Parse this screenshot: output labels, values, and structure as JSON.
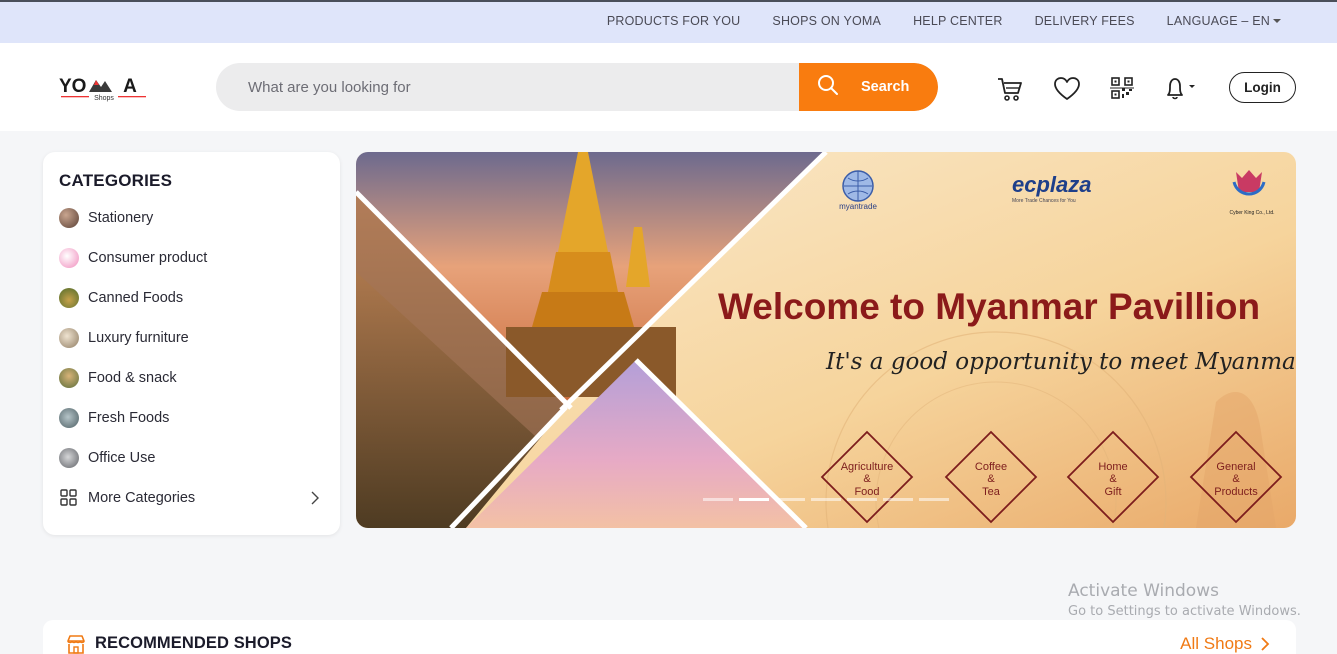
{
  "topbar": {
    "links": [
      "PRODUCTS FOR YOU",
      "SHOPS ON YOMA",
      "HELP CENTER",
      "DELIVERY FEES"
    ],
    "language": "LANGUAGE – EN"
  },
  "header": {
    "logo_text": "YOMA",
    "logo_sub": "Shops",
    "search_placeholder": "What are you looking for",
    "search_button": "Search",
    "login_label": "Login",
    "icons": [
      "cart-icon",
      "heart-icon",
      "qr-icon",
      "bell-icon"
    ]
  },
  "categories": {
    "title": "CATEGORIES",
    "items": [
      {
        "label": "Stationery",
        "color": "#8a6a5a"
      },
      {
        "label": "Consumer product",
        "color": "#f0a6c8"
      },
      {
        "label": "Canned Foods",
        "color": "#7a8a3a"
      },
      {
        "label": "Luxury furniture",
        "color": "#c9b9a0"
      },
      {
        "label": "Food & snack",
        "color": "#9a7a4a"
      },
      {
        "label": "Fresh Foods",
        "color": "#7b8f95"
      },
      {
        "label": "Office Use",
        "color": "#8d8f94"
      }
    ],
    "more_label": "More Categories"
  },
  "banner": {
    "headline": "Welcome to Myanmar Pavillion",
    "tagline": "It's a good opportunity to meet Myanmar suppliers",
    "logos": [
      "myantrade",
      "ecplaza",
      "Cyber King Co., Ltd."
    ],
    "ecplaza_sub": "More Trade Chances for You",
    "badges": [
      [
        "Agriculture",
        "&",
        "Food"
      ],
      [
        "Coffee",
        "&",
        "Tea"
      ],
      [
        "Home",
        "&",
        "Gift"
      ],
      [
        "General",
        "&",
        "Products"
      ]
    ],
    "active_slide": 2,
    "slide_count": 7
  },
  "watermark": {
    "line1": "Activate Windows",
    "line2": "Go to Settings to activate Windows."
  },
  "shops": {
    "title": "RECOMMENDED SHOPS",
    "all_label": "All Shops"
  },
  "colors": {
    "accent": "#f97c0f",
    "topbar_bg": "#dfe5fa",
    "headline": "#8b1a1a"
  }
}
